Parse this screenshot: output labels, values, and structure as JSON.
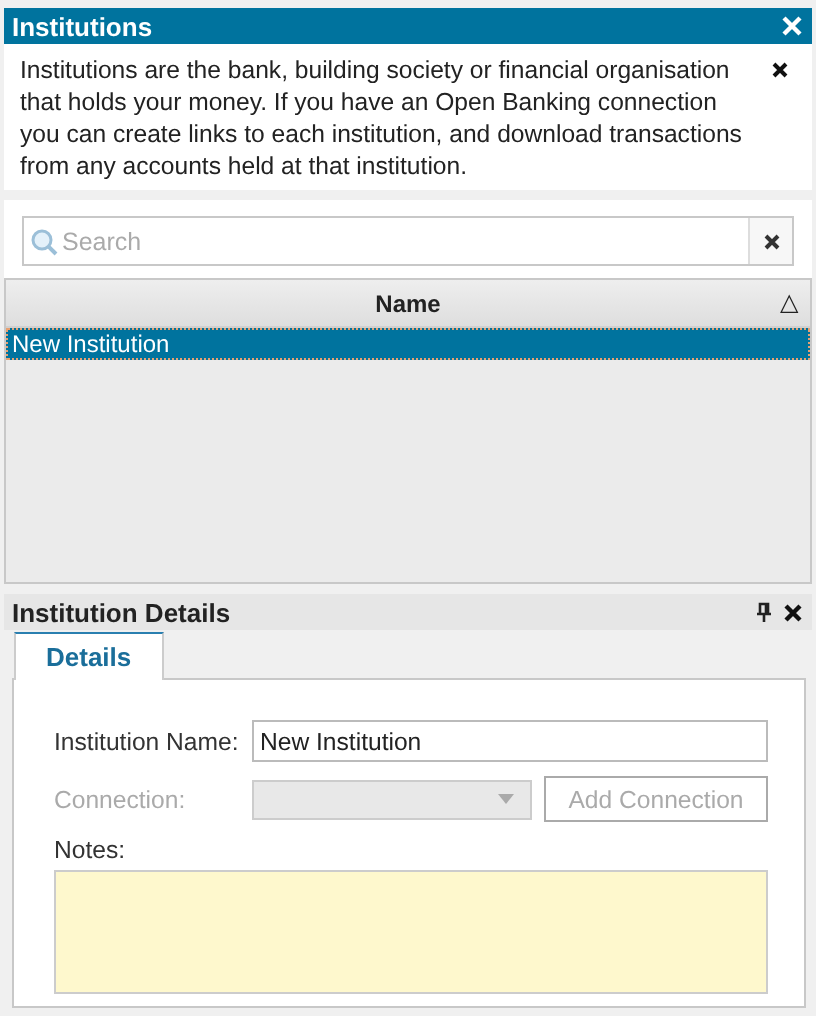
{
  "window": {
    "title": "Institutions"
  },
  "info": {
    "text": "Institutions are the bank, building society or financial organisation that holds your money.  If you have an Open Banking connection you can create links to each institution, and download transactions from any accounts held at that institution."
  },
  "search": {
    "placeholder": "Search"
  },
  "table": {
    "columns": [
      {
        "label": "Name",
        "sort": "△"
      }
    ],
    "rows": [
      {
        "name": "New Institution",
        "selected": true
      }
    ]
  },
  "details": {
    "title": "Institution Details",
    "tabs": [
      {
        "label": "Details",
        "selected": true
      }
    ],
    "fields": [
      {
        "kind": "text",
        "label": "Institution Name:",
        "value": "New Institution",
        "disabled": false
      },
      {
        "kind": "dropdown",
        "label": "Connection:",
        "disabled": true,
        "button": "Add Connection"
      },
      {
        "kind": "notes",
        "label": "Notes:",
        "disabled": false
      }
    ]
  }
}
